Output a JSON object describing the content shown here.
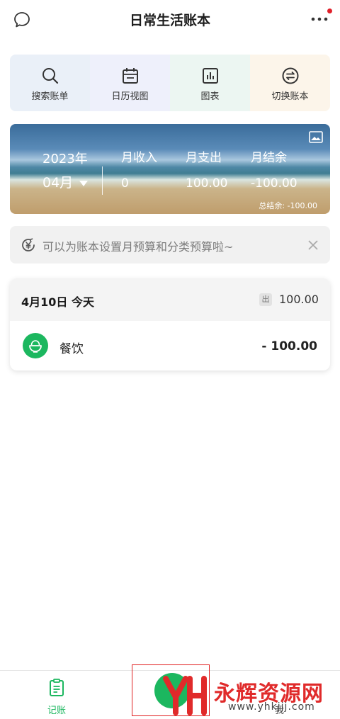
{
  "header": {
    "title": "日常生活账本"
  },
  "quick_actions": [
    {
      "label": "搜索账单",
      "icon": "search-icon",
      "bg": "#eaf0f8"
    },
    {
      "label": "日历视图",
      "icon": "calendar-icon",
      "bg": "#eef0fb"
    },
    {
      "label": "图表",
      "icon": "chart-icon",
      "bg": "#ecf6f2"
    },
    {
      "label": "切换账本",
      "icon": "switch-icon",
      "bg": "#fcf5ea"
    }
  ],
  "summary": {
    "year": "2023年",
    "month": "04月",
    "income_label": "月收入",
    "expense_label": "月支出",
    "balance_label": "月结余",
    "income": "0",
    "expense": "100.00",
    "balance": "-100.00",
    "total_balance": "总结余: -100.00"
  },
  "notice": {
    "text": "可以为账本设置月预算和分类预算啦~"
  },
  "records": {
    "date": "4月10日 今天",
    "out_badge": "出",
    "day_total": "100.00",
    "items": [
      {
        "category": "餐饮",
        "amount": "- 100.00"
      }
    ]
  },
  "nav": {
    "ledger_label": "记账",
    "mine_label": "我"
  },
  "watermark": {
    "text": "永辉资源网",
    "url": "www.yhkjjj.com"
  },
  "colors": {
    "accent": "#1cb75f",
    "notify": "#e0202a",
    "watermark": "#e02a2a"
  }
}
